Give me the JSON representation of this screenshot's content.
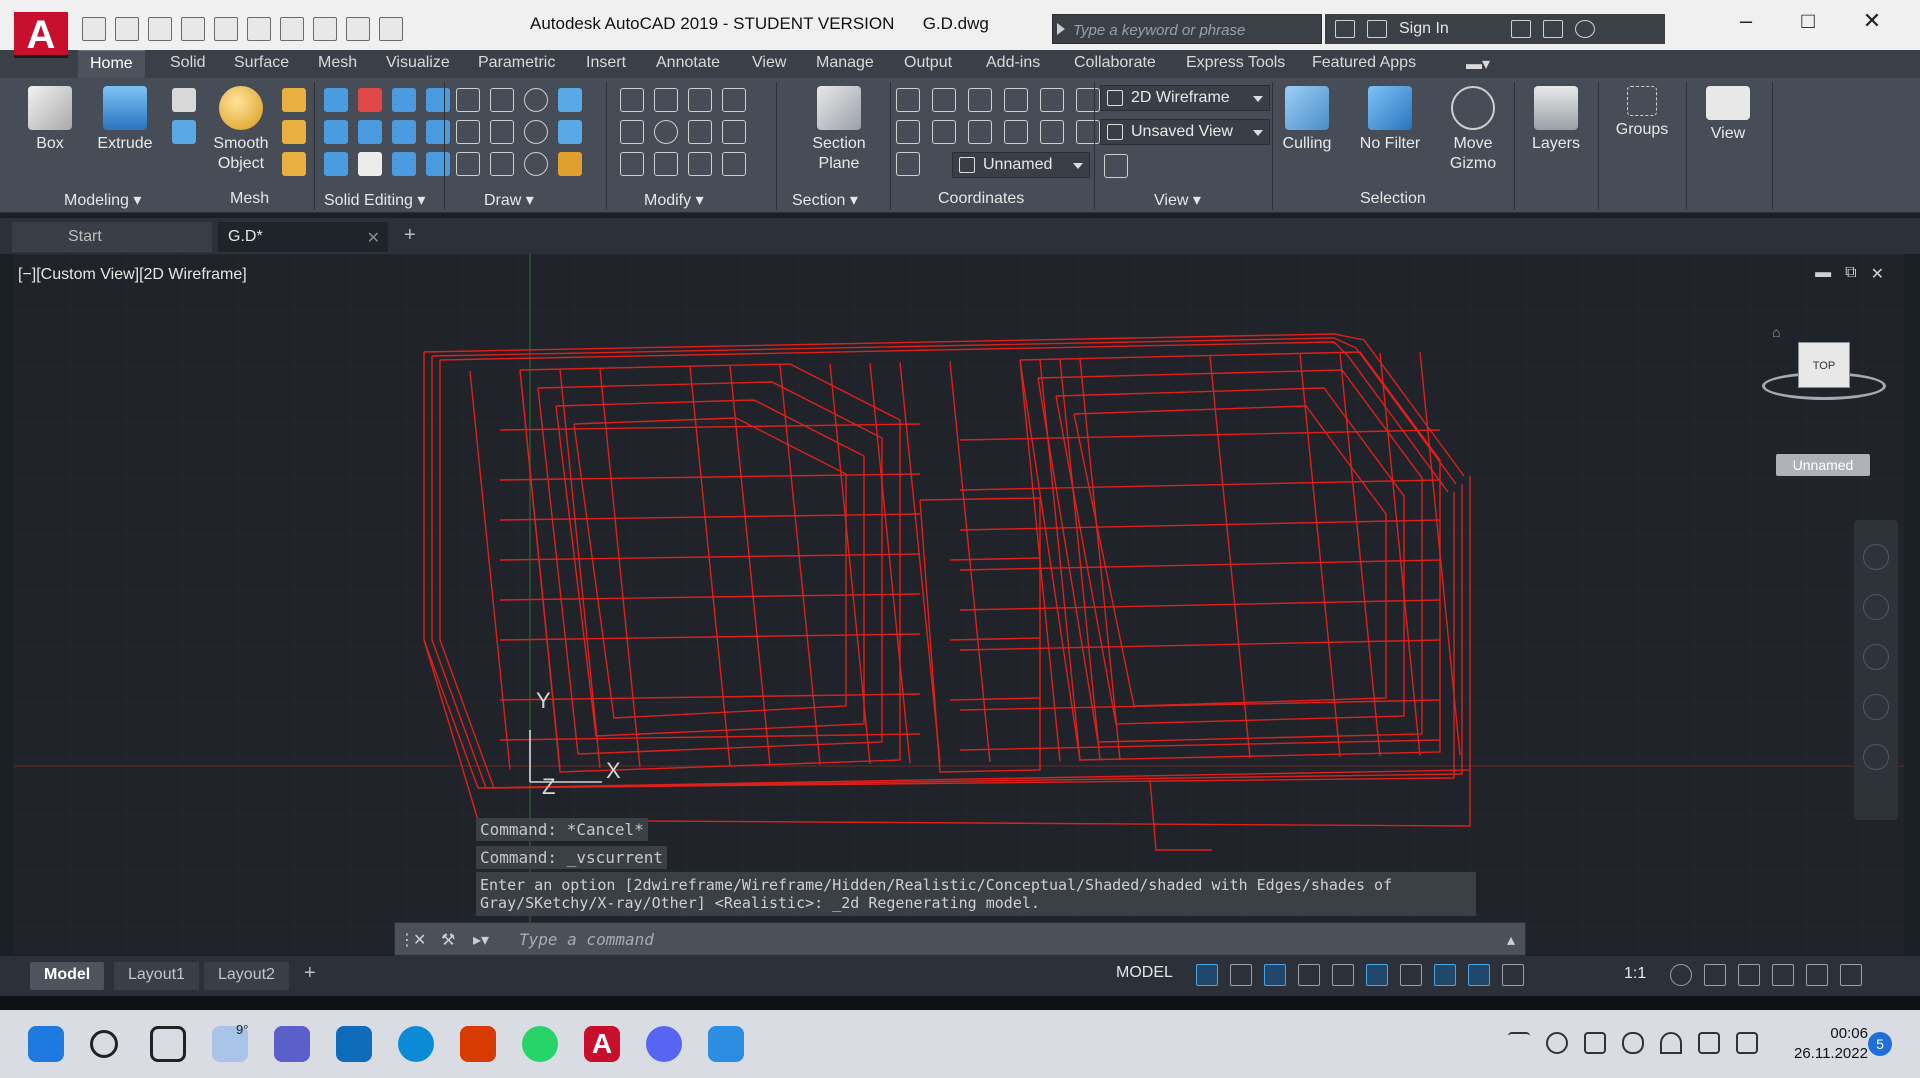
{
  "app": {
    "logo": "A",
    "title": "Autodesk AutoCAD 2019 - STUDENT VERSION      G.D.dwg"
  },
  "search": {
    "placeholder": "Type a keyword or phrase"
  },
  "account": {
    "sign_in": "Sign In"
  },
  "ribbon_tabs": [
    "Home",
    "Solid",
    "Surface",
    "Mesh",
    "Visualize",
    "Parametric",
    "Insert",
    "Annotate",
    "View",
    "Manage",
    "Output",
    "Add-ins",
    "Collaborate",
    "Express Tools",
    "Featured Apps"
  ],
  "ribbon": {
    "box": "Box",
    "extrude": "Extrude",
    "smooth_object": "Smooth\nObject",
    "section_plane": "Section\nPlane",
    "culling": "Culling",
    "no_filter": "No Filter",
    "move_gizmo": "Move\nGizmo",
    "layers": "Layers",
    "groups": "Groups",
    "view": "View",
    "visual_style": "2D Wireframe",
    "named_view": "Unsaved View",
    "ucs": "Unnamed",
    "panels": {
      "modeling": "Modeling",
      "mesh": "Mesh",
      "solid_editing": "Solid Editing",
      "draw": "Draw",
      "modify": "Modify",
      "section": "Section",
      "coordinates": "Coordinates",
      "view": "View",
      "selection": "Selection"
    }
  },
  "file_tabs": {
    "start": "Start",
    "doc": "G.D*"
  },
  "viewport": {
    "label": "[−][Custom View][2D Wireframe]",
    "viewcube_face": "TOP",
    "ucs_name": "Unnamed",
    "axis_y": "Y",
    "axis_x": "X",
    "axis_z": "Z"
  },
  "command": {
    "history": [
      "Command: *Cancel*",
      "Command: _vscurrent"
    ],
    "option_line1": "Enter an option [2dwireframe/Wireframe/Hidden/Realistic/Conceptual/Shaded/shaded with Edges/shades of",
    "option_line2": "Gray/SKetchy/X-ray/Other] <Realistic>: _2d Regenerating model.",
    "placeholder": "Type a command"
  },
  "layout_tabs": [
    "Model",
    "Layout1",
    "Layout2"
  ],
  "status": {
    "model": "MODEL",
    "scale": "1:1"
  },
  "taskbar": {
    "weather": "9°",
    "time": "00:06",
    "date": "26.11.2022",
    "notifications": "5"
  },
  "colors": {
    "wireframe": "#e0201b",
    "background": "#202329",
    "accent": "#c8102e"
  }
}
